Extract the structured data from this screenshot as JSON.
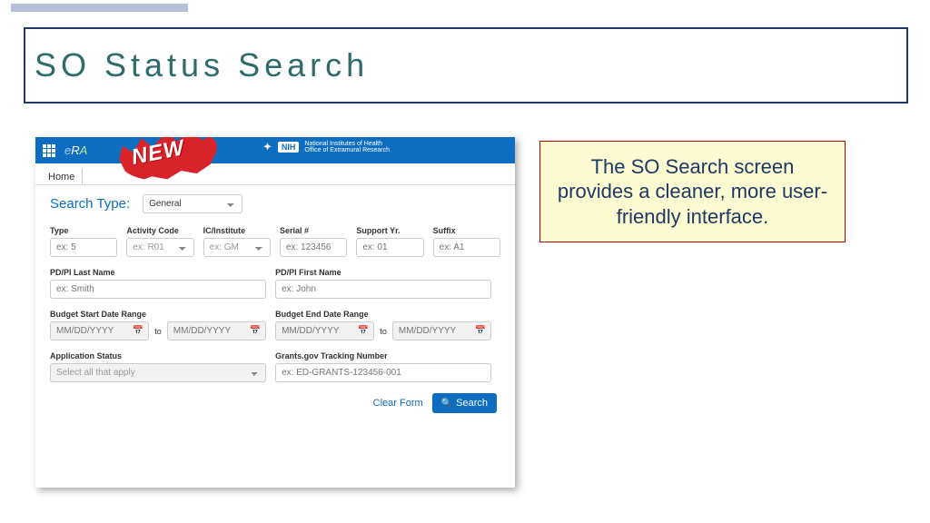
{
  "slide": {
    "title": "SO Status Search",
    "callout": "The SO Search screen provides a cleaner, more user-friendly interface."
  },
  "header": {
    "era": {
      "e": "e",
      "r": "R",
      "a": "A"
    },
    "nih_badge": "NIH",
    "nih_line1": "National Institutes of Health",
    "nih_line2": "Office of Extramural Research"
  },
  "ribbon": "NEW",
  "tabs": {
    "home": "Home"
  },
  "form": {
    "search_type_label": "Search Type:",
    "search_type_value": "General",
    "type": {
      "label": "Type",
      "ph": "ex: 5"
    },
    "activity": {
      "label": "Activity Code",
      "ph": "ex: R01"
    },
    "ic": {
      "label": "IC/Institute",
      "ph": "ex: GM"
    },
    "serial": {
      "label": "Serial #",
      "ph": "ex: 123456"
    },
    "support": {
      "label": "Support Yr.",
      "ph": "ex: 01"
    },
    "suffix": {
      "label": "Suffix",
      "ph": "ex: A1"
    },
    "pi_last": {
      "label": "PD/PI Last Name",
      "ph": "ex: Smith"
    },
    "pi_first": {
      "label": "PD/PI First Name",
      "ph": "ex: John"
    },
    "bstart": {
      "label": "Budget Start Date Range"
    },
    "bend": {
      "label": "Budget End Date Range"
    },
    "date_ph": "MM/DD/YYYY",
    "to": "to",
    "appstatus": {
      "label": "Application Status",
      "ph": "Select all that apply"
    },
    "tracking": {
      "label": "Grants.gov Tracking Number",
      "ph": "ex: ED-GRANTS-123456-001"
    },
    "clear": "Clear Form",
    "search": "Search"
  }
}
